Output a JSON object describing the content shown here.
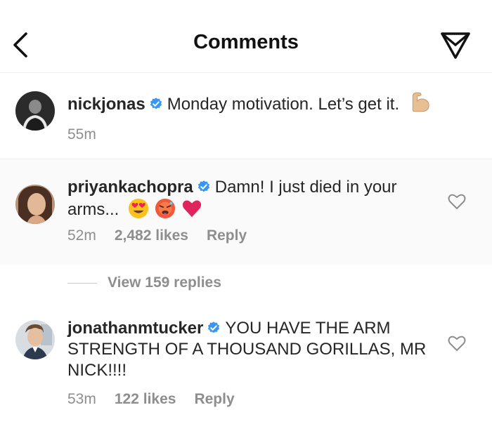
{
  "header": {
    "title": "Comments",
    "back_icon": "chevron-left-icon",
    "send_icon": "paper-plane-icon"
  },
  "caption": {
    "username": "nickjonas",
    "verified": true,
    "text": "Monday motivation. Let’s get it.",
    "emoji": "flexed-biceps",
    "time": "55m"
  },
  "comments": [
    {
      "username": "priyankachopra",
      "verified": true,
      "text": "Damn! I just died in your arms...",
      "emojis": [
        "heart-eyes-face",
        "hot-face",
        "red-heart"
      ],
      "time": "52m",
      "likes": "2,482 likes",
      "reply": "Reply",
      "view_replies": "View 159 replies"
    },
    {
      "username": "jonathanmtucker",
      "verified": true,
      "text": "YOU HAVE THE ARM STRENGTH OF A THOUSAND GORILLAS, MR NICK!!!!",
      "time": "53m",
      "likes": "122 likes",
      "reply": "Reply"
    }
  ],
  "colors": {
    "text": "#262626",
    "meta": "#8e8e8e",
    "verified": "#3897f0",
    "highlight_bg": "#fafafa",
    "divider": "#ededed",
    "red_heart": "#e0245e"
  }
}
